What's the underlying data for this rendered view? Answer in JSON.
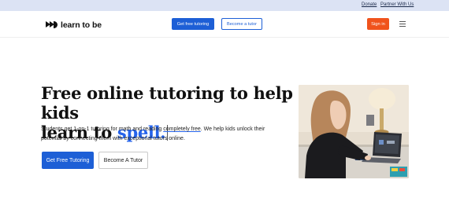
{
  "topbar": {
    "donate_label": "Donate",
    "partner_label": "Partner With Us"
  },
  "nav": {
    "logo_text": "learn to be",
    "get_tutoring_label": "Get free tutoring",
    "become_tutor_label": "Become a tutor",
    "signin_label": "Sign in"
  },
  "hero": {
    "title_line1": "Free online tutoring to help kids",
    "title_line2_prefix": "learn to ",
    "title_accent_word": "spell.",
    "desc_part1": "Students get 1-on-1 tutoring for math and reading ",
    "desc_underlined": "completely free",
    "desc_part2": ". We help kids unlock their potential by connecting them with exceptional tutors online.",
    "cta_primary": "Get Free Tutoring",
    "cta_secondary": "Become A Tutor"
  },
  "colors": {
    "brand_blue": "#1d5fd6",
    "accent_blue": "#2563eb",
    "signin_orange": "#f0531c",
    "topbar_bg": "#dce3f4"
  },
  "icons": {
    "logo": "play-dot-logo-icon",
    "menu": "hamburger-menu-icon"
  }
}
